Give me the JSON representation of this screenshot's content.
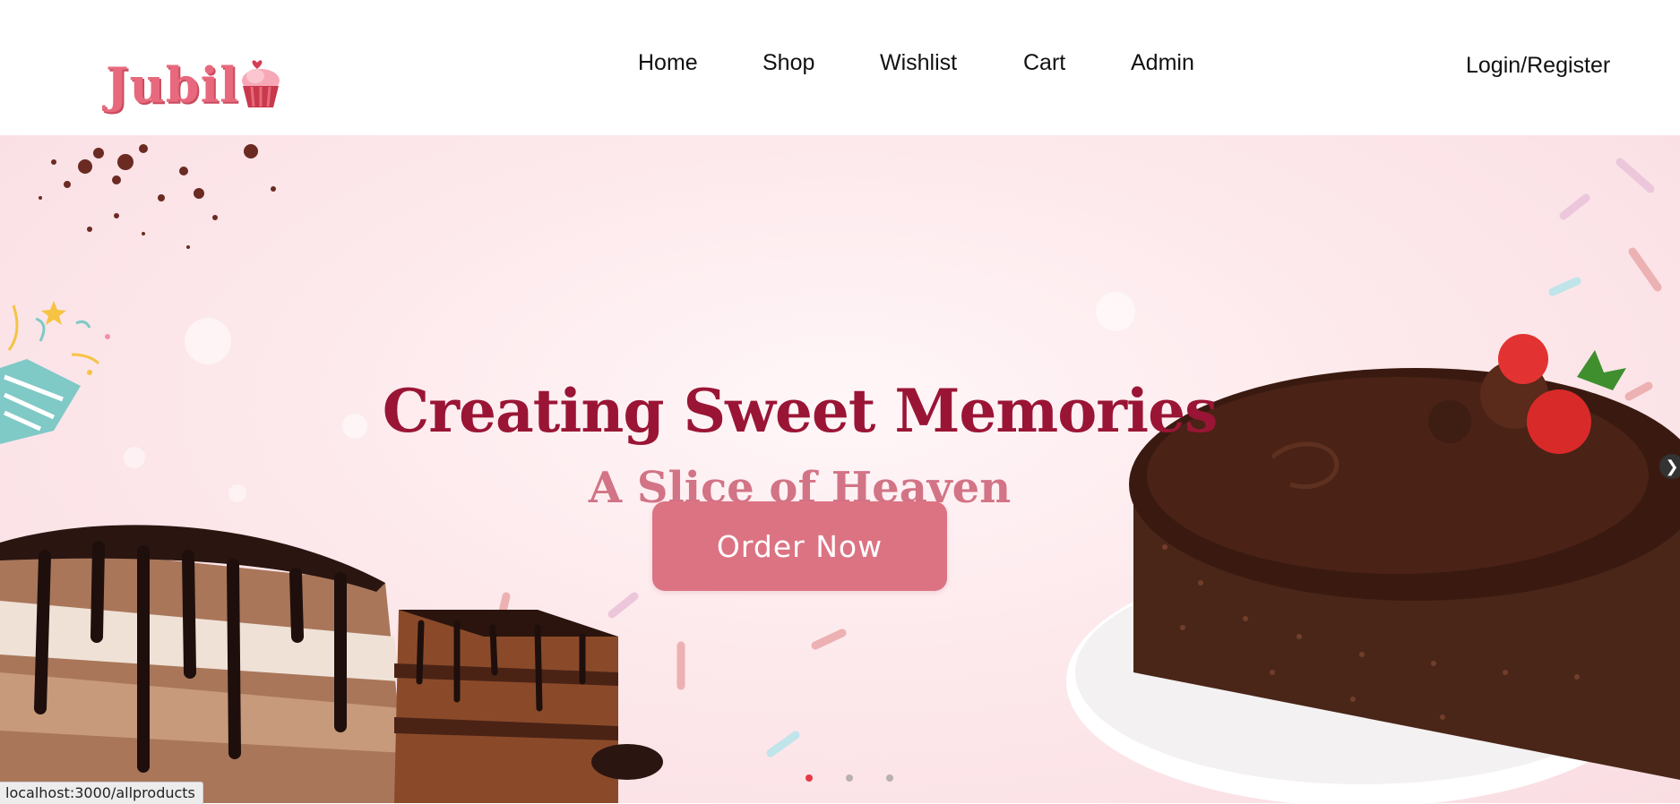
{
  "logo": {
    "text": "Jubil"
  },
  "nav": [
    {
      "label": "Home"
    },
    {
      "label": "Shop"
    },
    {
      "label": "Wishlist"
    },
    {
      "label": "Cart"
    },
    {
      "label": "Admin"
    }
  ],
  "auth": {
    "label": "Login/Register"
  },
  "hero": {
    "title": "Creating Sweet Memories",
    "subtitle": "A Slice of Heaven",
    "cta_label": "Order Now",
    "next_icon": "chevron-right-icon",
    "slides_count": 3,
    "active_slide": 1
  },
  "status_bar": {
    "url": "localhost:3000/allproducts"
  },
  "colors": {
    "brand_pink": "#e8697d",
    "title_crimson": "#9a1535",
    "subtitle_pink": "#d27486",
    "button_pink": "#dc7383",
    "active_dot": "#e63946"
  }
}
